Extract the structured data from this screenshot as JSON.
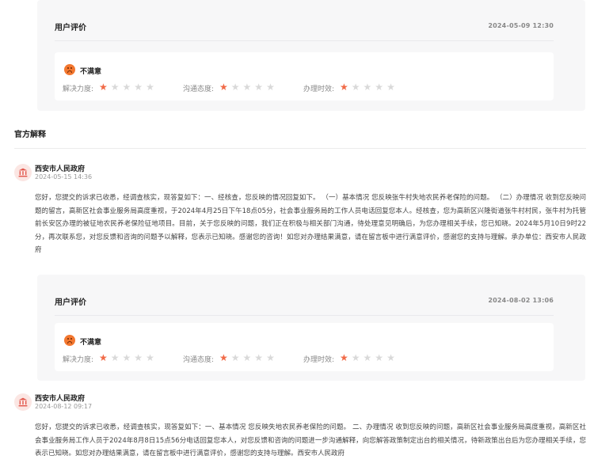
{
  "eval_cards": [
    {
      "title": "用户评价",
      "date": "2024-05-09 12:30",
      "mood": "不满意",
      "ratings": [
        {
          "label": "解决力度:",
          "stars": 1,
          "max": 5
        },
        {
          "label": "沟通态度:",
          "stars": 1,
          "max": 5
        },
        {
          "label": "办理时效:",
          "stars": 1,
          "max": 5
        }
      ]
    },
    {
      "title": "用户评价",
      "date": "2024-08-02 13:06",
      "mood": "不满意",
      "ratings": [
        {
          "label": "解决力度:",
          "stars": 1,
          "max": 5
        },
        {
          "label": "沟通态度:",
          "stars": 1,
          "max": 5
        },
        {
          "label": "办理时效:",
          "stars": 1,
          "max": 5
        }
      ]
    }
  ],
  "official": {
    "section_title": "官方解释",
    "replies": [
      {
        "org": "西安市人民政府",
        "date": "2024-05-15 14:36",
        "body": "您好，您提交的诉求已收悉，经调查核实，现答复如下：一、经核查，您反映的情况回复如下。 （一）基本情况 您反映张牛村失地农民养老保险的问题。 （二）办理情况 收到您反映问题的留言，高新区社会事业服务局高度重视，于2024年4月25日下午18点05分，社会事业服务局的工作人员电话回复您本人。经核查，您为高新区兴隆街道张牛村村民，张牛村为托管前长安区办理的被征地农民养老保险征地项目。目前，关于您反映的问题，我们正在积极与相关部门沟通，待处理意见明确后，为您办理相关手续，您已知晓。2024年5月10日9时22分，再次联系您，对您反馈和咨询的问题予以解释，您表示已知晓。感谢您的咨询！如您对办理结果满意，请在留言板中进行满意评价，感谢您的支持与理解。承办单位：西安市人民政府"
      },
      {
        "org": "西安市人民政府",
        "date": "2024-08-12 09:17",
        "body": "您好，您提交的诉求已收悉，经调查核实，现答复如下：一、基本情况 您反映失地农民养老保险的问题。 二、办理情况 收到您反映的问题，高新区社会事业服务局高度重视，高新区社会事业服务局工作人员于2024年8月8日15点56分电话回复您本人，对您反馈和咨询的问题进一步沟通解释，向您解答政策制定出台的相关情况，待新政策出台后为您办理相关手续，您表示已知晓。如您对办理结果满意，请在留言板中进行满意评价，感谢您的支持与理解。西安市人民政府"
      }
    ]
  },
  "colors": {
    "star_on": "#f16a47",
    "star_off": "#d9d9d9",
    "face": "#f3772f",
    "card_bg": "#f7f7f8"
  },
  "icons": {
    "star": "★",
    "face": "sad-face-icon",
    "avatar": "bank-icon"
  }
}
